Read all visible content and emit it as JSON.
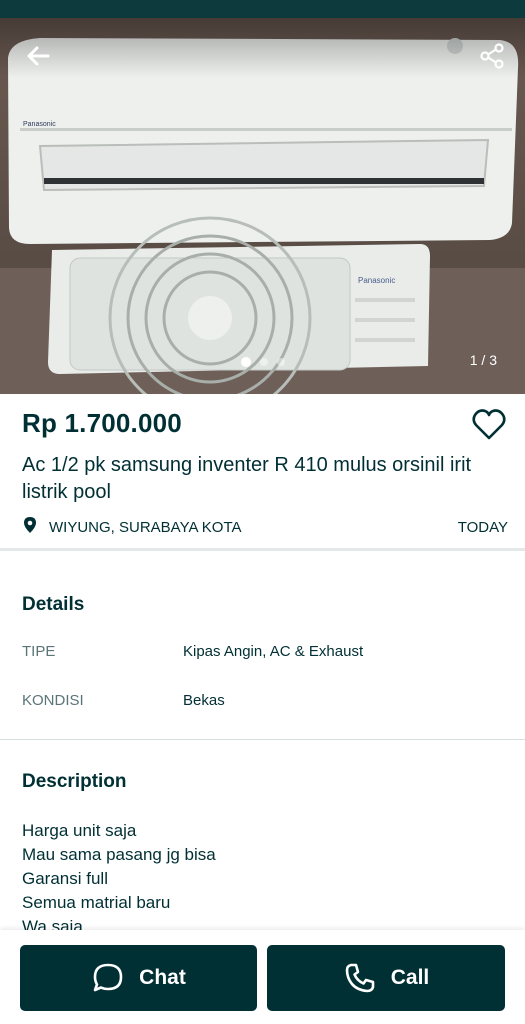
{
  "listing": {
    "price": "Rp 1.700.000",
    "title": "Ac 1/2 pk samsung inventer R 410 mulus orsinil irit listrik pool",
    "location": "WIYUNG, SURABAYA KOTA",
    "date": "TODAY"
  },
  "gallery": {
    "counter": "1 / 3",
    "current_index": 1,
    "total": 3,
    "brand_label": "Panasonic"
  },
  "details": {
    "heading": "Details",
    "rows": [
      {
        "label": "TIPE",
        "value": "Kipas Angin, AC & Exhaust"
      },
      {
        "label": "KONDISI",
        "value": "Bekas"
      }
    ]
  },
  "description": {
    "heading": "Description",
    "lines": [
      "Harga unit saja",
      "Mau sama pasang jg bisa",
      "Garansi full",
      "Semua matrial baru",
      "Wa saja"
    ]
  },
  "actions": {
    "chat_label": "Chat",
    "call_label": "Call"
  },
  "colors": {
    "primary": "#002f34",
    "muted": "#5b7477"
  },
  "icons": [
    "back-arrow-icon",
    "share-icon",
    "heart-icon",
    "location-pin-icon",
    "chat-bubble-icon",
    "phone-icon"
  ]
}
